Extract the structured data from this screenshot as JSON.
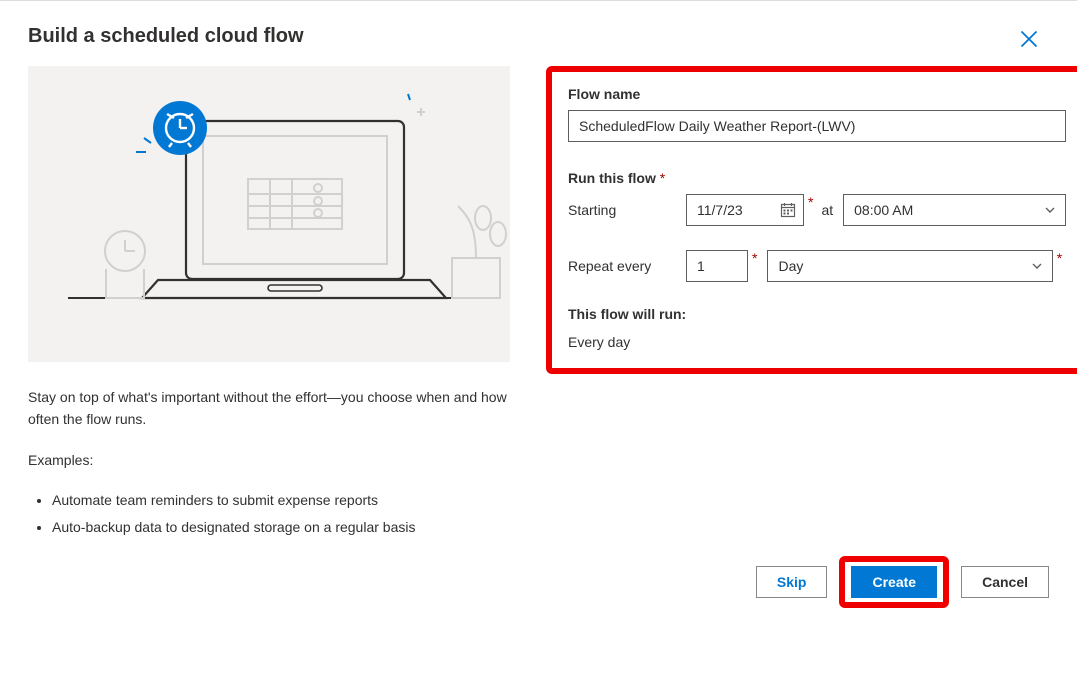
{
  "dialog": {
    "title": "Build a scheduled cloud flow"
  },
  "illustration": {
    "clock_icon": "alarm-clock"
  },
  "description": {
    "intro": "Stay on top of what's important without the effort—you choose when and how often the flow runs.",
    "examples_label": "Examples:",
    "examples": [
      "Automate team reminders to submit expense reports",
      "Auto-backup data to designated storage on a regular basis"
    ]
  },
  "form": {
    "flow_name_label": "Flow name",
    "flow_name_value": "ScheduledFlow Daily Weather Report-(LWV)",
    "run_label": "Run this flow",
    "starting_label": "Starting",
    "starting_date": "11/7/23",
    "at_label": "at",
    "starting_time": "08:00 AM",
    "repeat_label": "Repeat every",
    "repeat_count": "1",
    "repeat_unit": "Day",
    "summary_label": "This flow will run:",
    "summary_text": "Every day"
  },
  "footer": {
    "skip": "Skip",
    "create": "Create",
    "cancel": "Cancel"
  }
}
